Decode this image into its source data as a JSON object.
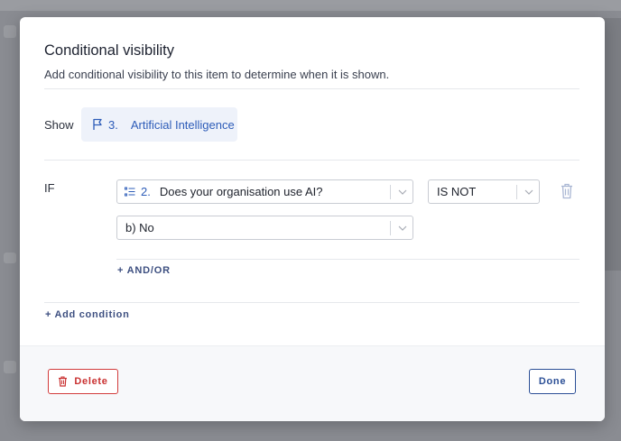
{
  "modal": {
    "title": "Conditional visibility",
    "subtitle": "Add conditional visibility to this item to determine when it is shown."
  },
  "show": {
    "label": "Show",
    "item_number": "3.",
    "item_title": "Artificial Intelligence",
    "icon": "flag-icon"
  },
  "condition": {
    "if_label": "IF",
    "question": {
      "number": "2.",
      "text": "Does your organisation use AI?",
      "icon": "list-question-icon"
    },
    "operator": "IS NOT",
    "answer": "b) No",
    "and_or_label": "+ AND/OR"
  },
  "add_condition_label": "+ Add condition",
  "footer": {
    "delete_label": "Delete",
    "done_label": "Done"
  },
  "colors": {
    "accent": "#2d5cb8",
    "danger": "#c93030",
    "chip_bg": "#eef2fa"
  }
}
